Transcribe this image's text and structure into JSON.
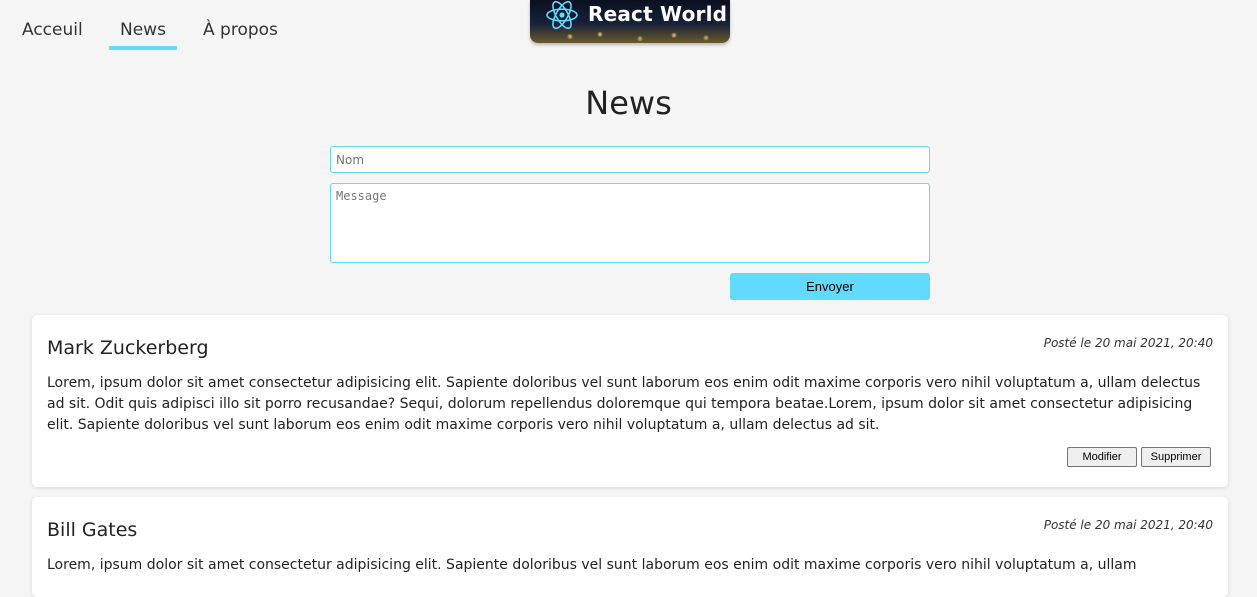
{
  "nav": {
    "items": [
      {
        "label": "Acceuil"
      },
      {
        "label": "News"
      },
      {
        "label": "À propos"
      }
    ],
    "active_index": 1
  },
  "logo": {
    "text": "React World",
    "icon": "react-atom-icon",
    "accent": "#61dafb"
  },
  "page": {
    "title": "News"
  },
  "form": {
    "name_placeholder": "Nom",
    "message_placeholder": "Message",
    "submit_label": "Envoyer"
  },
  "posts": [
    {
      "author": "Mark Zuckerberg",
      "date": "Posté le 20 mai 2021, 20:40",
      "text": "Lorem, ipsum dolor sit amet consectetur adipisicing elit. Sapiente doloribus vel sunt laborum eos enim odit maxime corporis vero nihil voluptatum a, ullam delectus ad sit. Odit quis adipisci illo sit porro recusandae? Sequi, dolorum repellendus doloremque qui tempora beatae.Lorem, ipsum dolor sit amet consectetur adipisicing elit. Sapiente doloribus vel sunt laborum eos enim odit maxime corporis vero nihil voluptatum a, ullam delectus ad sit.",
      "edit_label": "Modifier",
      "delete_label": "Supprimer"
    },
    {
      "author": "Bill Gates",
      "date": "Posté le 20 mai 2021, 20:40",
      "text": "Lorem, ipsum dolor sit amet consectetur adipisicing elit. Sapiente doloribus vel sunt laborum eos enim odit maxime corporis vero nihil voluptatum a, ullam"
    }
  ]
}
